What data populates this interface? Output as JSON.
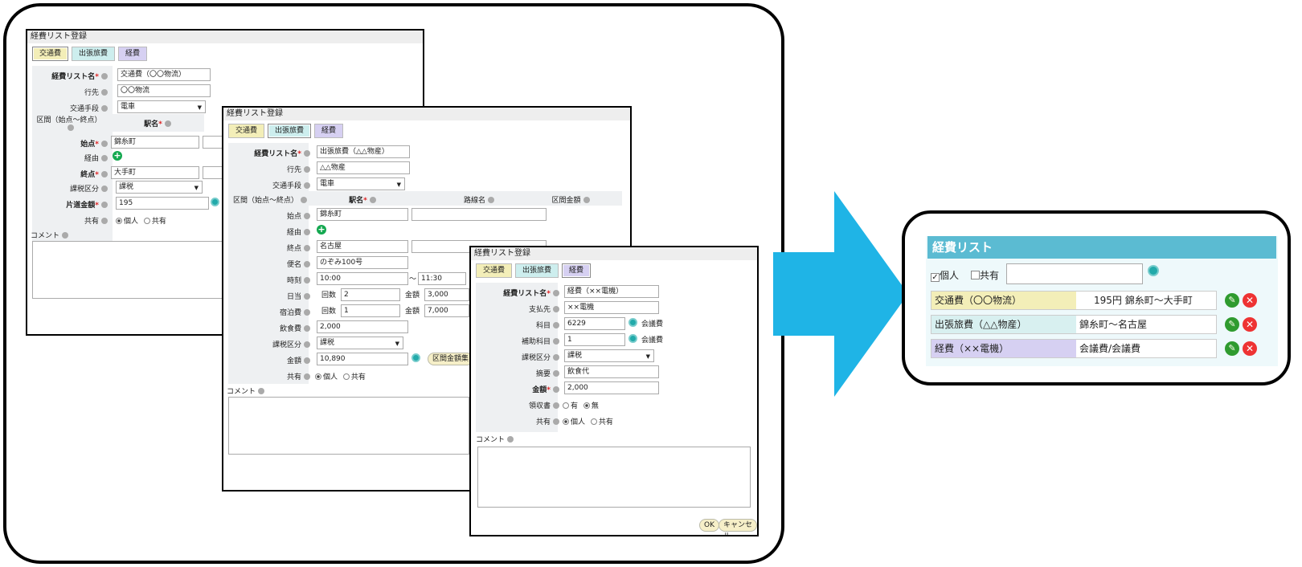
{
  "common": {
    "window_title": "経費リスト登録",
    "tab_transport": "交通費",
    "tab_trip": "出張旅費",
    "tab_expense": "経費",
    "label_list_name": "経費リスト名",
    "label_destination": "行先",
    "label_transport_means": "交通手段",
    "label_section": "区間（始点～終点）",
    "label_station": "駅名",
    "label_line": "路線名",
    "label_section_amount": "区間金額",
    "label_start": "始点",
    "label_via": "経由",
    "label_end": "終点",
    "label_tax": "課税区分",
    "label_oneway": "片道金額",
    "label_share": "共有",
    "opt_personal": "個人",
    "opt_shared": "共有",
    "label_comment": "コメント",
    "required_mark": "*"
  },
  "form1": {
    "list_name": "交通費（〇〇物流）",
    "destination": "〇〇物流",
    "transport": "電車",
    "start": "錦糸町",
    "end": "大手町",
    "tax": "課税",
    "oneway": "195"
  },
  "form2": {
    "list_name": "出張旅費（△△物産）",
    "destination": "△△物産",
    "transport": "電車",
    "start": "錦糸町",
    "end": "名古屋",
    "label_train": "便名",
    "train": "のぞみ100号",
    "label_time": "時刻",
    "time_from": "10:00",
    "time_sep": "～",
    "time_to": "11:30",
    "label_daily": "日当",
    "label_count": "回数",
    "daily_count": "2",
    "label_amount_small": "金額",
    "daily_amount": "3,000",
    "label_lodging": "宿泊費",
    "lodging_count": "1",
    "lodging_amount": "7,000",
    "label_food": "飲食費",
    "food": "2,000",
    "tax": "課税",
    "label_amount": "金額",
    "amount": "10,890",
    "section_btn": "区間金額集"
  },
  "form3": {
    "list_name": "経費（××電機）",
    "label_payee": "支払先",
    "payee": "××電機",
    "label_subject": "科目",
    "subject": "6229",
    "subject_name": "会議費",
    "label_sub_subject": "補助科目",
    "sub_subject": "1",
    "sub_subject_name": "会議費",
    "tax": "課税",
    "label_summary": "摘要",
    "summary": "飲食代",
    "label_amount": "金額",
    "amount": "2,000",
    "label_receipt": "領収書",
    "opt_yes": "有",
    "opt_no": "無",
    "ok": "OK",
    "cancel": "キャンセル"
  },
  "list_panel": {
    "title": "経費リスト",
    "filter_personal": "個人",
    "filter_shared": "共有",
    "search_value": "",
    "rows": [
      {
        "name": "交通費（〇〇物流）",
        "detail": "195円 錦糸町～大手町",
        "color": "#f3eeb8"
      },
      {
        "name": "出張旅費（△△物産）",
        "detail": "錦糸町～名古屋",
        "color": "#d8f0f0"
      },
      {
        "name": "経費（××電機）",
        "detail": "会議費/会議費",
        "color": "#d6d0f2"
      }
    ]
  },
  "colors": {
    "arrow": "#1fb4e6",
    "panel_header": "#5bbbd2"
  }
}
